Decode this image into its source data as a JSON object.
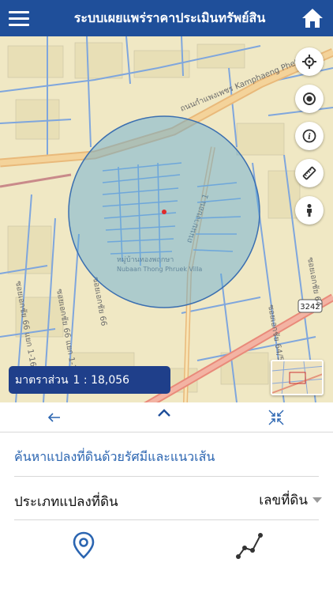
{
  "header": {
    "title": "ระบบเผยแพร่ราคาประเมินทรัพย์สิน",
    "menu_icon": "menu-icon",
    "home_icon": "home-icon"
  },
  "map": {
    "road_labels": [
      "ถนนกำแพงเพชร Kamphaeng Phet",
      "ถนนบางบอน 1",
      "ซอยเอกชัย 66",
      "ซอยเอกชัย 66 แยก 1-10",
      "ซอยเอกชัย 66 แยก 1-16",
      "ซอยเอกชัย 64/5",
      "ซอยเอกชัย 64"
    ],
    "place_label": "หมู่บ้านทองพฤกษา",
    "place_label_en": "Nubaan Thong Phruek Villa",
    "road_shield": "3242",
    "tools": [
      "locate-icon",
      "target-icon",
      "info-icon",
      "ruler-icon",
      "person-icon"
    ]
  },
  "scale": {
    "label": "มาตราส่วน",
    "value": "1 : 18,056"
  },
  "panel": {
    "back_icon": "arrow-left-icon",
    "collapse_icon": "chevron-up-icon",
    "shrink_icon": "collapse-arrows-icon",
    "search_title": "ค้นหาแปลงที่ดินด้วยรัศมีและแนวเส้น",
    "parcel_type_label": "ประเภทแปลงที่ดิน",
    "parcel_type_value": "เลขที่ดิน"
  },
  "tabs": {
    "radius_icon": "map-pin-icon",
    "line_icon": "polyline-icon"
  },
  "colors": {
    "primary": "#1f4f9a",
    "accent_text": "#2b65b1",
    "circle_fill": "#5aa8d8",
    "marker": "#e02b2b"
  }
}
